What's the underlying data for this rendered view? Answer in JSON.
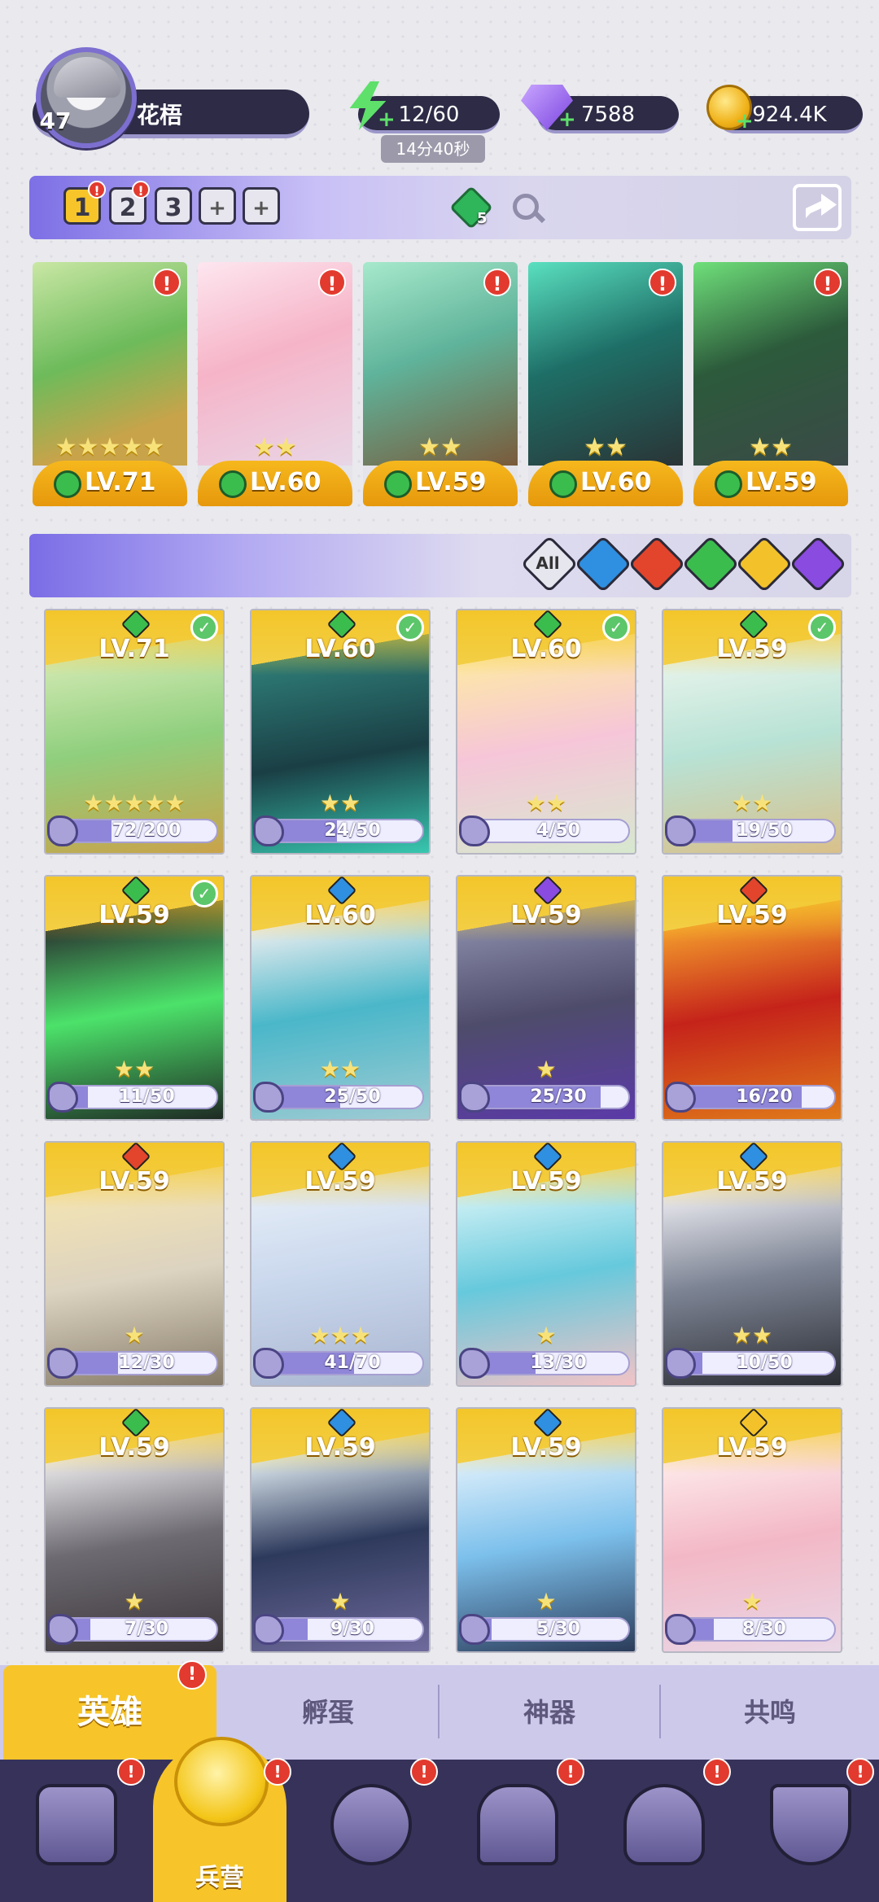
{
  "player": {
    "level": "47",
    "name": "花梧"
  },
  "resources": {
    "energy": "12/60",
    "energy_timer": "14分40秒",
    "gems": "7588",
    "coins": "924.4K"
  },
  "team_bar": {
    "slots": [
      "1",
      "2",
      "3"
    ],
    "plus_slots": [
      "+",
      "+"
    ],
    "gem_count": "5"
  },
  "team": [
    {
      "level": "LV.71",
      "stars": "★★★★★"
    },
    {
      "level": "LV.60",
      "stars": "★★"
    },
    {
      "level": "LV.59",
      "stars": "★★"
    },
    {
      "level": "LV.60",
      "stars": "★★"
    },
    {
      "level": "LV.59",
      "stars": "★★"
    }
  ],
  "filters": {
    "all_label": "All",
    "items": [
      "all",
      "water",
      "fire",
      "nature",
      "light",
      "dark"
    ]
  },
  "heroes": [
    {
      "level": "LV.71",
      "element": "nature",
      "progress": "72/200",
      "checked": true,
      "stars": "★★★★★"
    },
    {
      "level": "LV.60",
      "element": "nature",
      "progress": "24/50",
      "checked": true,
      "stars": "★★"
    },
    {
      "level": "LV.60",
      "element": "nature",
      "progress": "4/50",
      "checked": true,
      "stars": "★★"
    },
    {
      "level": "LV.59",
      "element": "nature",
      "progress": "19/50",
      "checked": true,
      "stars": "★★"
    },
    {
      "level": "LV.59",
      "element": "nature",
      "progress": "11/50",
      "checked": true,
      "stars": "★★"
    },
    {
      "level": "LV.60",
      "element": "water",
      "progress": "25/50",
      "checked": false,
      "stars": "★★"
    },
    {
      "level": "LV.59",
      "element": "dark",
      "progress": "25/30",
      "checked": false,
      "stars": "★"
    },
    {
      "level": "LV.59",
      "element": "fire",
      "progress": "16/20",
      "checked": false,
      "stars": ""
    },
    {
      "level": "LV.59",
      "element": "fire",
      "progress": "12/30",
      "checked": false,
      "stars": "★"
    },
    {
      "level": "LV.59",
      "element": "water",
      "progress": "41/70",
      "checked": false,
      "stars": "★★★"
    },
    {
      "level": "LV.59",
      "element": "water",
      "progress": "13/30",
      "checked": false,
      "stars": "★"
    },
    {
      "level": "LV.59",
      "element": "water",
      "progress": "10/50",
      "checked": false,
      "stars": "★★"
    },
    {
      "level": "LV.59",
      "element": "nature",
      "progress": "7/30",
      "checked": false,
      "stars": "★"
    },
    {
      "level": "LV.59",
      "element": "water",
      "progress": "9/30",
      "checked": false,
      "stars": "★"
    },
    {
      "level": "LV.59",
      "element": "water",
      "progress": "5/30",
      "checked": false,
      "stars": "★"
    },
    {
      "level": "LV.59",
      "element": "light",
      "progress": "8/30",
      "checked": false,
      "stars": "★"
    }
  ],
  "sub_tabs": [
    "英雄",
    "孵蛋",
    "神器",
    "共鸣"
  ],
  "nav": {
    "active_label": "兵营"
  },
  "colors": {
    "nature": "#3bbd4e",
    "water": "#2f8fe0",
    "fire": "#e2452c",
    "light": "#f3c22a",
    "dark": "#8a4be0",
    "all": "#e6e6ee",
    "accent": "#f7c52a",
    "panel": "#2d2b45"
  }
}
